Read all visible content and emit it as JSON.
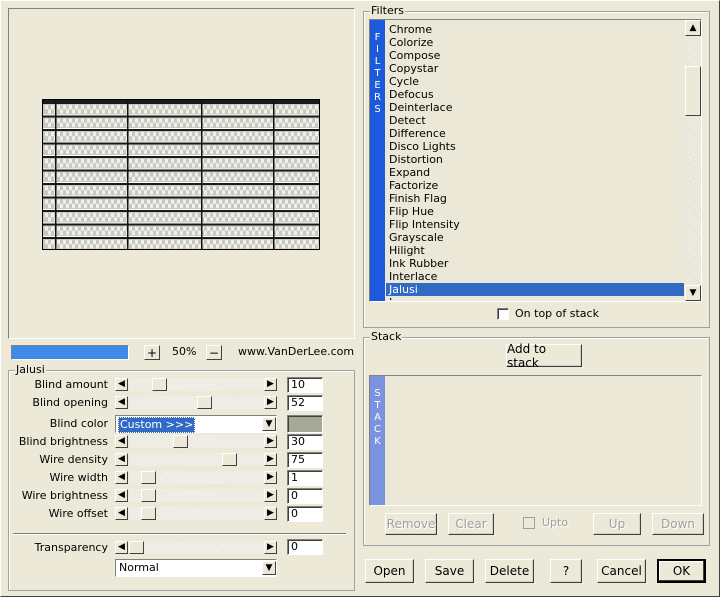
{
  "preview": {
    "zoom": "50%",
    "zoom_in": "+",
    "zoom_out": "−",
    "credit": "www.VanDerLee.com",
    "progress": 1.0
  },
  "params": {
    "group_title": "Jalusi",
    "sliders": [
      {
        "label": "Blind amount",
        "value": "10",
        "fraction": 0.1
      },
      {
        "label": "Blind opening",
        "value": "52",
        "fraction": 0.52
      },
      {
        "label": "Blind brightness",
        "value": "30",
        "fraction": 0.3
      },
      {
        "label": "Wire density",
        "value": "75",
        "fraction": 0.75
      },
      {
        "label": "Wire width",
        "value": "1",
        "fraction": 0.0
      },
      {
        "label": "Wire brightness",
        "value": "0",
        "fraction": 0.0
      },
      {
        "label": "Wire offset",
        "value": "0",
        "fraction": 0.0
      }
    ],
    "blind_color": {
      "label": "Blind color",
      "value": "Custom >>>",
      "swatch": "#a8a898"
    },
    "transparency": {
      "label": "Transparency",
      "value": "0",
      "fraction": 0.0
    },
    "blend_mode": "Normal"
  },
  "filters": {
    "title": "Filters",
    "side_label": [
      "F",
      "I",
      "L",
      "T",
      "E",
      "R",
      "S"
    ],
    "items": [
      "Chrome",
      "Colorize",
      "Compose",
      "Copystar",
      "Cycle",
      "Defocus",
      "Deinterlace",
      "Detect",
      "Difference",
      "Disco Lights",
      "Distortion",
      "Expand",
      "Factorize",
      "Finish Flag",
      "Flip Hue",
      "Flip Intensity",
      "Grayscale",
      "Hilight",
      "Ink Rubber",
      "Interlace",
      "Jalusi",
      "Laserwave"
    ],
    "selected": "Jalusi",
    "on_top_label": "On top of stack",
    "on_top_checked": false
  },
  "stack": {
    "title": "Stack",
    "add_label": "Add to stack",
    "side_label": [
      "S",
      "T",
      "A",
      "C",
      "K"
    ],
    "remove_label": "Remove",
    "clear_label": "Clear",
    "upto_label": "Upto",
    "up_label": "Up",
    "down_label": "Down"
  },
  "footer": {
    "open": "Open",
    "save": "Save",
    "delete": "Delete",
    "help": "?",
    "cancel": "Cancel",
    "ok": "OK"
  },
  "colors": {
    "accent": "#1c5adb",
    "selection": "#316ac5",
    "progress": "#3f8ae9",
    "list_bg": "#ece8d8"
  }
}
